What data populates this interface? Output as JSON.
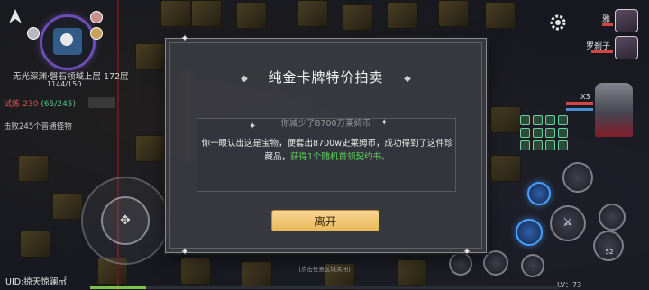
{
  "hud": {
    "location_text": "无光深渊·磐石领域上层 172层",
    "location_progress": "1144/150",
    "trial_label": "试炼",
    "trial_value": "-230",
    "trial_count": "(65/245)",
    "kill_text": "击败245个普通怪物",
    "uid_text": "UID:掠天惊澜㎡",
    "level_text": "LV：73",
    "stack_text": "X3",
    "party": [
      {
        "name": "雅"
      },
      {
        "name": "罗刹子"
      }
    ],
    "skill_counter": "52"
  },
  "modal": {
    "title": "纯金卡牌特价拍卖",
    "subtitle": "你减少了8700万莱姆币",
    "description_main": "你一眼认出这是宝物，便套出8700w史莱姆币，成功得到了这件珍藏品，",
    "description_reward": "获得1个随机首领契约书。",
    "leave_label": "离开",
    "close_hint": "[点击任意区域关闭]"
  },
  "colors": {
    "modal_bg": "#3a3c42",
    "button_gold": "#f0c674",
    "reward_green": "#5fd35f",
    "trial_red": "#e05252",
    "trial_green": "#4ec98a",
    "minimap_ring": "#6b4fb6"
  }
}
